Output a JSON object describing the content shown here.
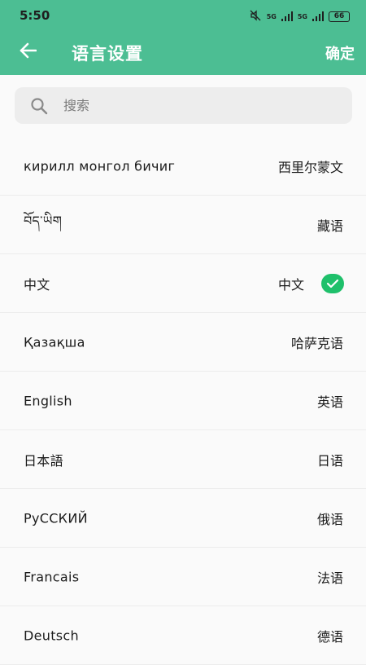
{
  "status_bar": {
    "time": "5:50",
    "network_1": "5G",
    "network_2": "5G",
    "battery": "66"
  },
  "appbar": {
    "back_icon": "arrow-left-icon",
    "title": "语言设置",
    "confirm_label": "确定",
    "color": "#4cbe93"
  },
  "search": {
    "placeholder": "搜索",
    "value": "",
    "icon": "search-icon"
  },
  "languages": [
    {
      "native": "кирилл монгол бичиг",
      "chinese": "西里尔蒙文",
      "selected": false
    },
    {
      "native": "བོད་ཡིག",
      "chinese": "藏语",
      "selected": false
    },
    {
      "native": "中文",
      "chinese": "中文",
      "selected": true
    },
    {
      "native": "Қазақша",
      "chinese": "哈萨克语",
      "selected": false
    },
    {
      "native": "English",
      "chinese": "英语",
      "selected": false
    },
    {
      "native": "日本語",
      "chinese": "日语",
      "selected": false
    },
    {
      "native": "РуССКИЙ",
      "chinese": "俄语",
      "selected": false
    },
    {
      "native": "Francais",
      "chinese": "法语",
      "selected": false
    },
    {
      "native": "Deutsch",
      "chinese": "德语",
      "selected": false
    }
  ],
  "selected_check_color": "#1fc06b"
}
